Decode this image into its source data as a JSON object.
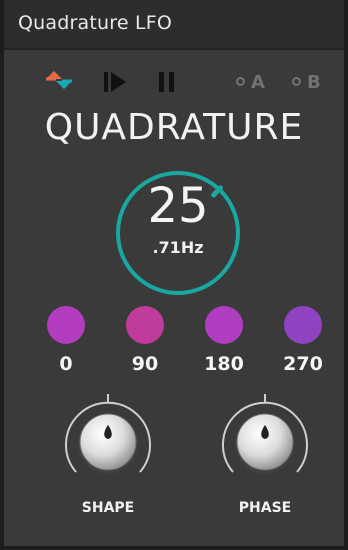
{
  "window": {
    "title": "Quadrature LFO"
  },
  "toolbar": {
    "waveform_icon": "waveform-triangle-icon",
    "play_icon": "play-icon",
    "pause_icon": "pause-icon",
    "option_a_label": "A",
    "option_b_label": "B"
  },
  "mode": {
    "title": "QUADRATURE"
  },
  "rate": {
    "value": "25",
    "hz": ".71Hz",
    "accent_color": "#19a7a0",
    "indicator_fraction": 0.12
  },
  "phases": [
    {
      "label": "0",
      "color": "#b23dbf"
    },
    {
      "label": "90",
      "color": "#c03c9a"
    },
    {
      "label": "180",
      "color": "#b03ec0"
    },
    {
      "label": "270",
      "color": "#8f43c0"
    }
  ],
  "knobs": [
    {
      "label": "SHAPE"
    },
    {
      "label": "PHASE"
    }
  ]
}
